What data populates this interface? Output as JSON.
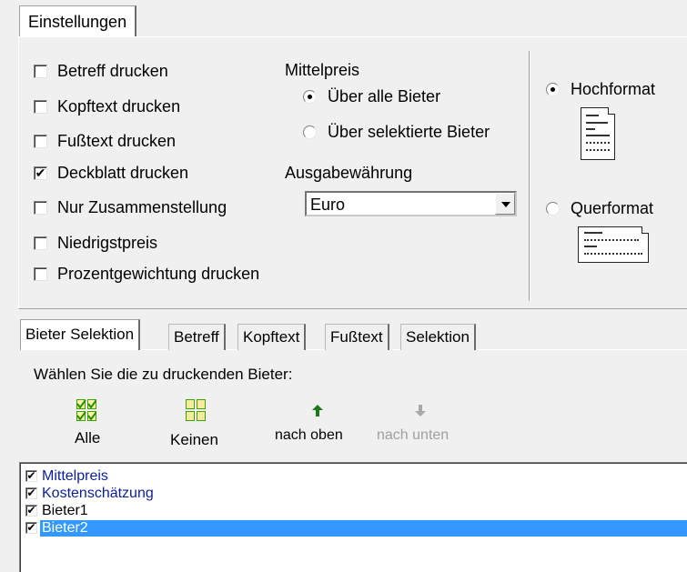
{
  "main_tab": {
    "label": "Einstellungen"
  },
  "options": {
    "checkboxes": [
      {
        "label": "Betreff drucken",
        "checked": false
      },
      {
        "label": "Kopftext drucken",
        "checked": false
      },
      {
        "label": "Fußtext drucken",
        "checked": false
      },
      {
        "label": "Deckblatt drucken",
        "checked": true
      },
      {
        "label": "Nur Zusammenstellung",
        "checked": false
      },
      {
        "label": "Niedrigstpreis",
        "checked": false
      },
      {
        "label": "Prozentgewichtung drucken",
        "checked": false
      }
    ],
    "mittelpreis": {
      "title": "Mittelpreis",
      "options": [
        {
          "label": "Über alle Bieter",
          "selected": true
        },
        {
          "label": "Über selektierte Bieter",
          "selected": false
        }
      ]
    },
    "currency": {
      "title": "Ausgabewährung",
      "value": "Euro"
    },
    "orientation": {
      "options": [
        {
          "label": "Hochformat",
          "selected": true,
          "icon": "portrait-page-icon"
        },
        {
          "label": "Querformat",
          "selected": false,
          "icon": "landscape-page-icon"
        }
      ]
    }
  },
  "sub_tabs": [
    {
      "label": "Bieter Selektion",
      "active": true
    },
    {
      "label": "Betreff",
      "active": false
    },
    {
      "label": "Kopftext",
      "active": false
    },
    {
      "label": "Fußtext",
      "active": false
    },
    {
      "label": "Selektion",
      "active": false
    }
  ],
  "bieter": {
    "prompt": "Wählen Sie die zu druckenden Bieter:",
    "toolbar": {
      "all": {
        "label": "Alle",
        "icon": "check-all-icon"
      },
      "none": {
        "label": "Keinen",
        "icon": "uncheck-all-icon"
      },
      "up": {
        "label": "nach oben",
        "icon": "arrow-up-icon",
        "enabled": true
      },
      "down": {
        "label": "nach unten",
        "icon": "arrow-down-icon",
        "enabled": false
      }
    },
    "list": [
      {
        "label": "Mittelpreis",
        "checked": true,
        "selected": false
      },
      {
        "label": "Kostenschätzung",
        "checked": true,
        "selected": false
      },
      {
        "label": "Bieter1",
        "checked": true,
        "selected": false
      },
      {
        "label": "Bieter2",
        "checked": true,
        "selected": true
      }
    ]
  },
  "colors": {
    "selection": "#3399ff",
    "list_text": "#0b1f9a",
    "check_icon": "#3aa600",
    "arrow_enabled": "#1a7a1a"
  }
}
